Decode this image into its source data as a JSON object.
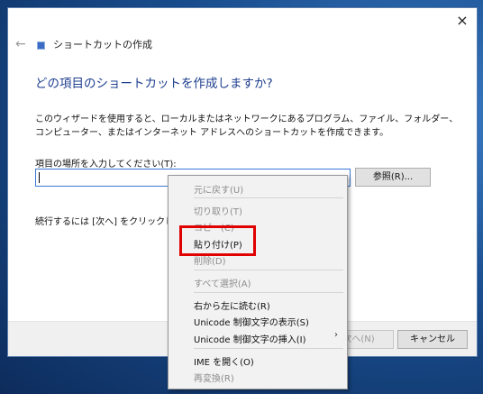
{
  "wizard": {
    "title": "ショートカットの作成",
    "heading": "どの項目のショートカットを作成しますか?",
    "description": "このウィザードを使用すると、ローカルまたはネットワークにあるプログラム、ファイル、フォルダー、コンピューター、またはインターネット アドレスへのショートカットを作成できます。",
    "location_label": "項目の場所を入力してください(T):",
    "location_value": "",
    "browse_label": "参照(R)...",
    "continue_text": "続行するには [次へ] をクリックしてく",
    "next_label": "次へ(N)",
    "cancel_label": "キャンセル",
    "close_glyph": "×",
    "back_glyph": "←"
  },
  "context_menu": {
    "undo": "元に戻す(U)",
    "cut": "切り取り(T)",
    "copy": "コピー(C)",
    "paste": "貼り付け(P)",
    "delete": "削除(D)",
    "select_all": "すべて選択(A)",
    "rtl": "右から左に読む(R)",
    "show_unicode": "Unicode 制御文字の表示(S)",
    "insert_unicode": "Unicode 制御文字の挿入(I)",
    "open_ime": "IME を開く(O)",
    "reconvert": "再変換(R)",
    "submenu_glyph": "›"
  },
  "colors": {
    "heading": "#1e3f8f",
    "highlight": "#e00000",
    "input_border": "#3b78d6"
  }
}
